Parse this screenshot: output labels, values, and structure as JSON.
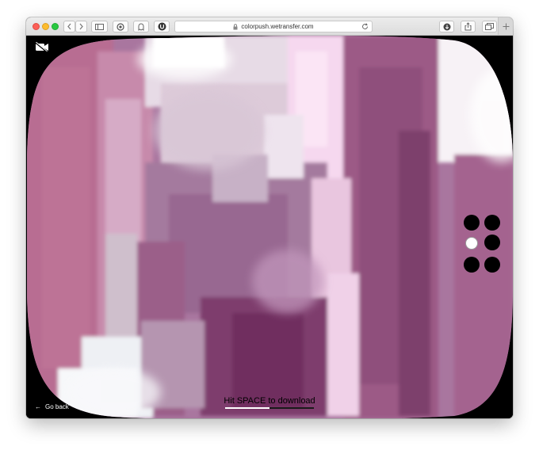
{
  "browser": {
    "url": "colorpush.wetransfer.com"
  },
  "overlay": {
    "go_back_arrow": "←",
    "go_back_label": "Go back",
    "hint": "Hit SPACE to download"
  },
  "icons": {
    "camera": "camera-off-icon",
    "back": "arrow-left-icon",
    "reload": "reload-icon",
    "lock": "lock-icon",
    "download": "download-icon",
    "share": "share-icon",
    "tabs": "tabs-icon",
    "sidebar": "sidebar-icon",
    "new_tab": "plus-icon"
  },
  "selector": {
    "count": 6,
    "active_index": 2
  },
  "progress": {
    "fraction": 0.5
  },
  "colors": {
    "mauve": "#b46d93",
    "plum": "#7b3d69",
    "lilac": "#a7789f",
    "pale_pink": "#f3d4ec",
    "white_haze": "#f1eff3"
  }
}
